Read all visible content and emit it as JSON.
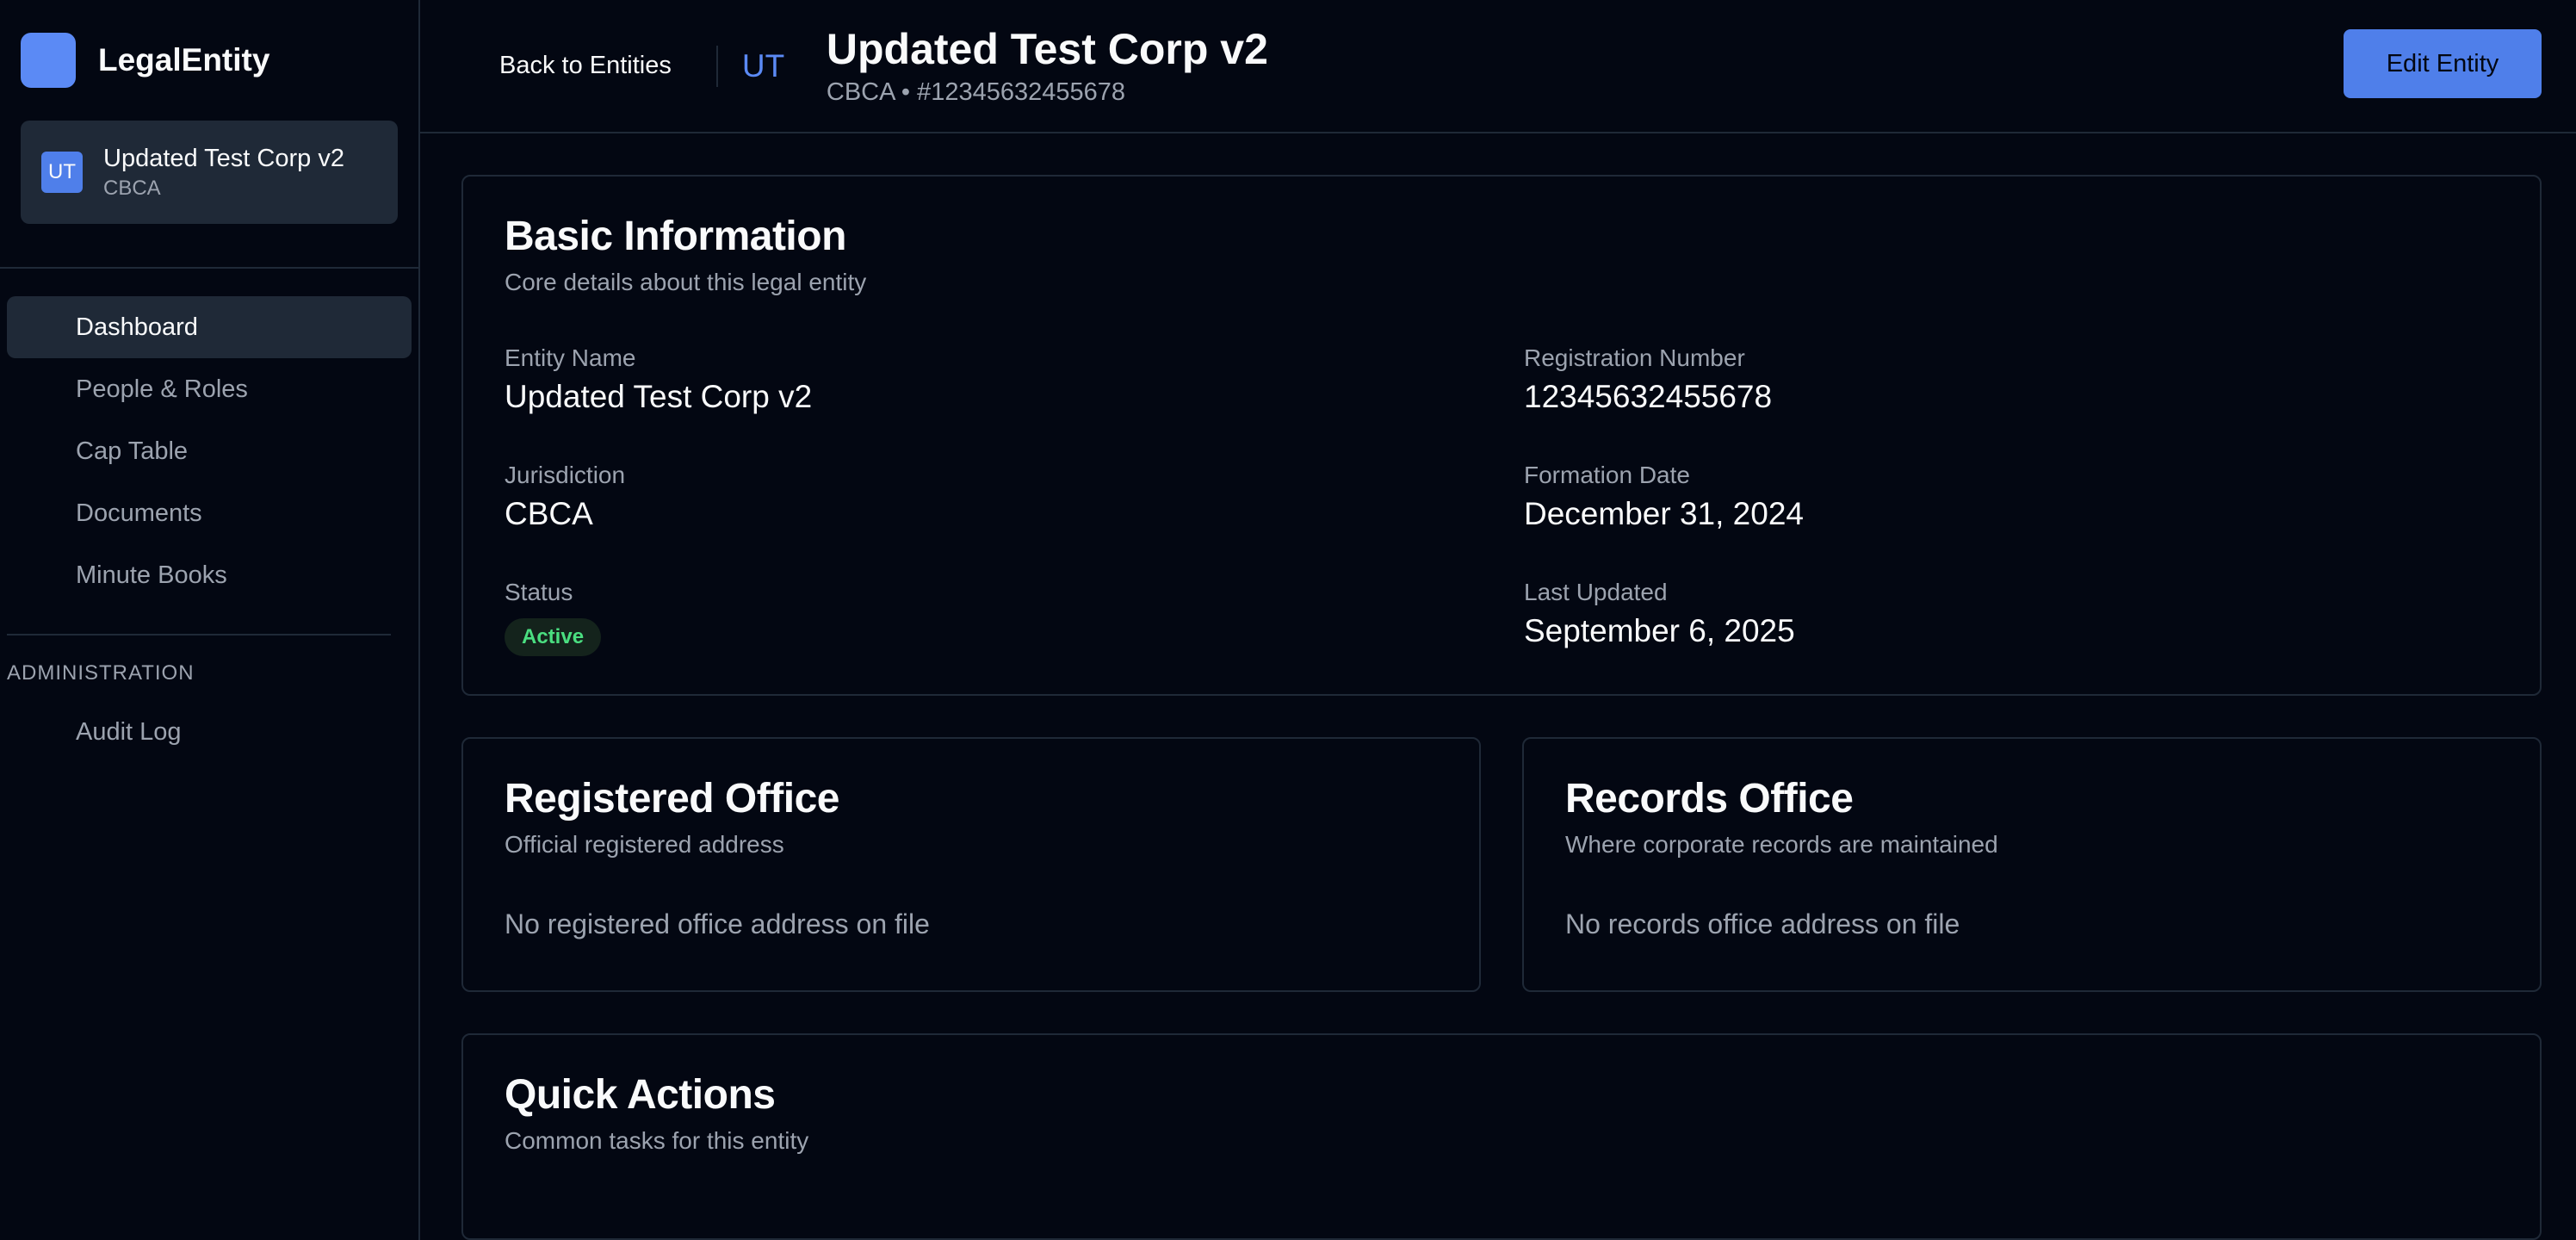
{
  "app": {
    "name": "LegalEntity"
  },
  "sidebar": {
    "entity": {
      "initials": "UT",
      "name": "Updated Test Corp v2",
      "jurisdiction": "CBCA"
    },
    "nav": [
      {
        "label": "Dashboard",
        "active": true
      },
      {
        "label": "People & Roles"
      },
      {
        "label": "Cap Table"
      },
      {
        "label": "Documents"
      },
      {
        "label": "Minute Books"
      }
    ],
    "admin_section": "ADMINISTRATION",
    "admin_nav": [
      {
        "label": "Audit Log"
      }
    ]
  },
  "header": {
    "back_label": "Back to Entities",
    "initials": "UT",
    "title": "Updated Test Corp v2",
    "subtitle": "CBCA • #12345632455678",
    "edit_label": "Edit Entity"
  },
  "basic_info": {
    "title": "Basic Information",
    "description": "Core details about this legal entity",
    "entity_name": {
      "label": "Entity Name",
      "value": "Updated Test Corp v2"
    },
    "registration_number": {
      "label": "Registration Number",
      "value": "12345632455678"
    },
    "jurisdiction": {
      "label": "Jurisdiction",
      "value": "CBCA"
    },
    "formation_date": {
      "label": "Formation Date",
      "value": "December 31, 2024"
    },
    "status": {
      "label": "Status",
      "value": "Active"
    },
    "last_updated": {
      "label": "Last Updated",
      "value": "September 6, 2025"
    }
  },
  "registered_office": {
    "title": "Registered Office",
    "description": "Official registered address",
    "empty": "No registered office address on file"
  },
  "records_office": {
    "title": "Records Office",
    "description": "Where corporate records are maintained",
    "empty": "No records office address on file"
  },
  "quick_actions": {
    "title": "Quick Actions",
    "description": "Common tasks for this entity"
  },
  "colors": {
    "background": "#030712",
    "accent": "#4f7fea",
    "border": "#1f2937",
    "muted_text": "#9ca3af",
    "status_active": "#4ade80"
  }
}
